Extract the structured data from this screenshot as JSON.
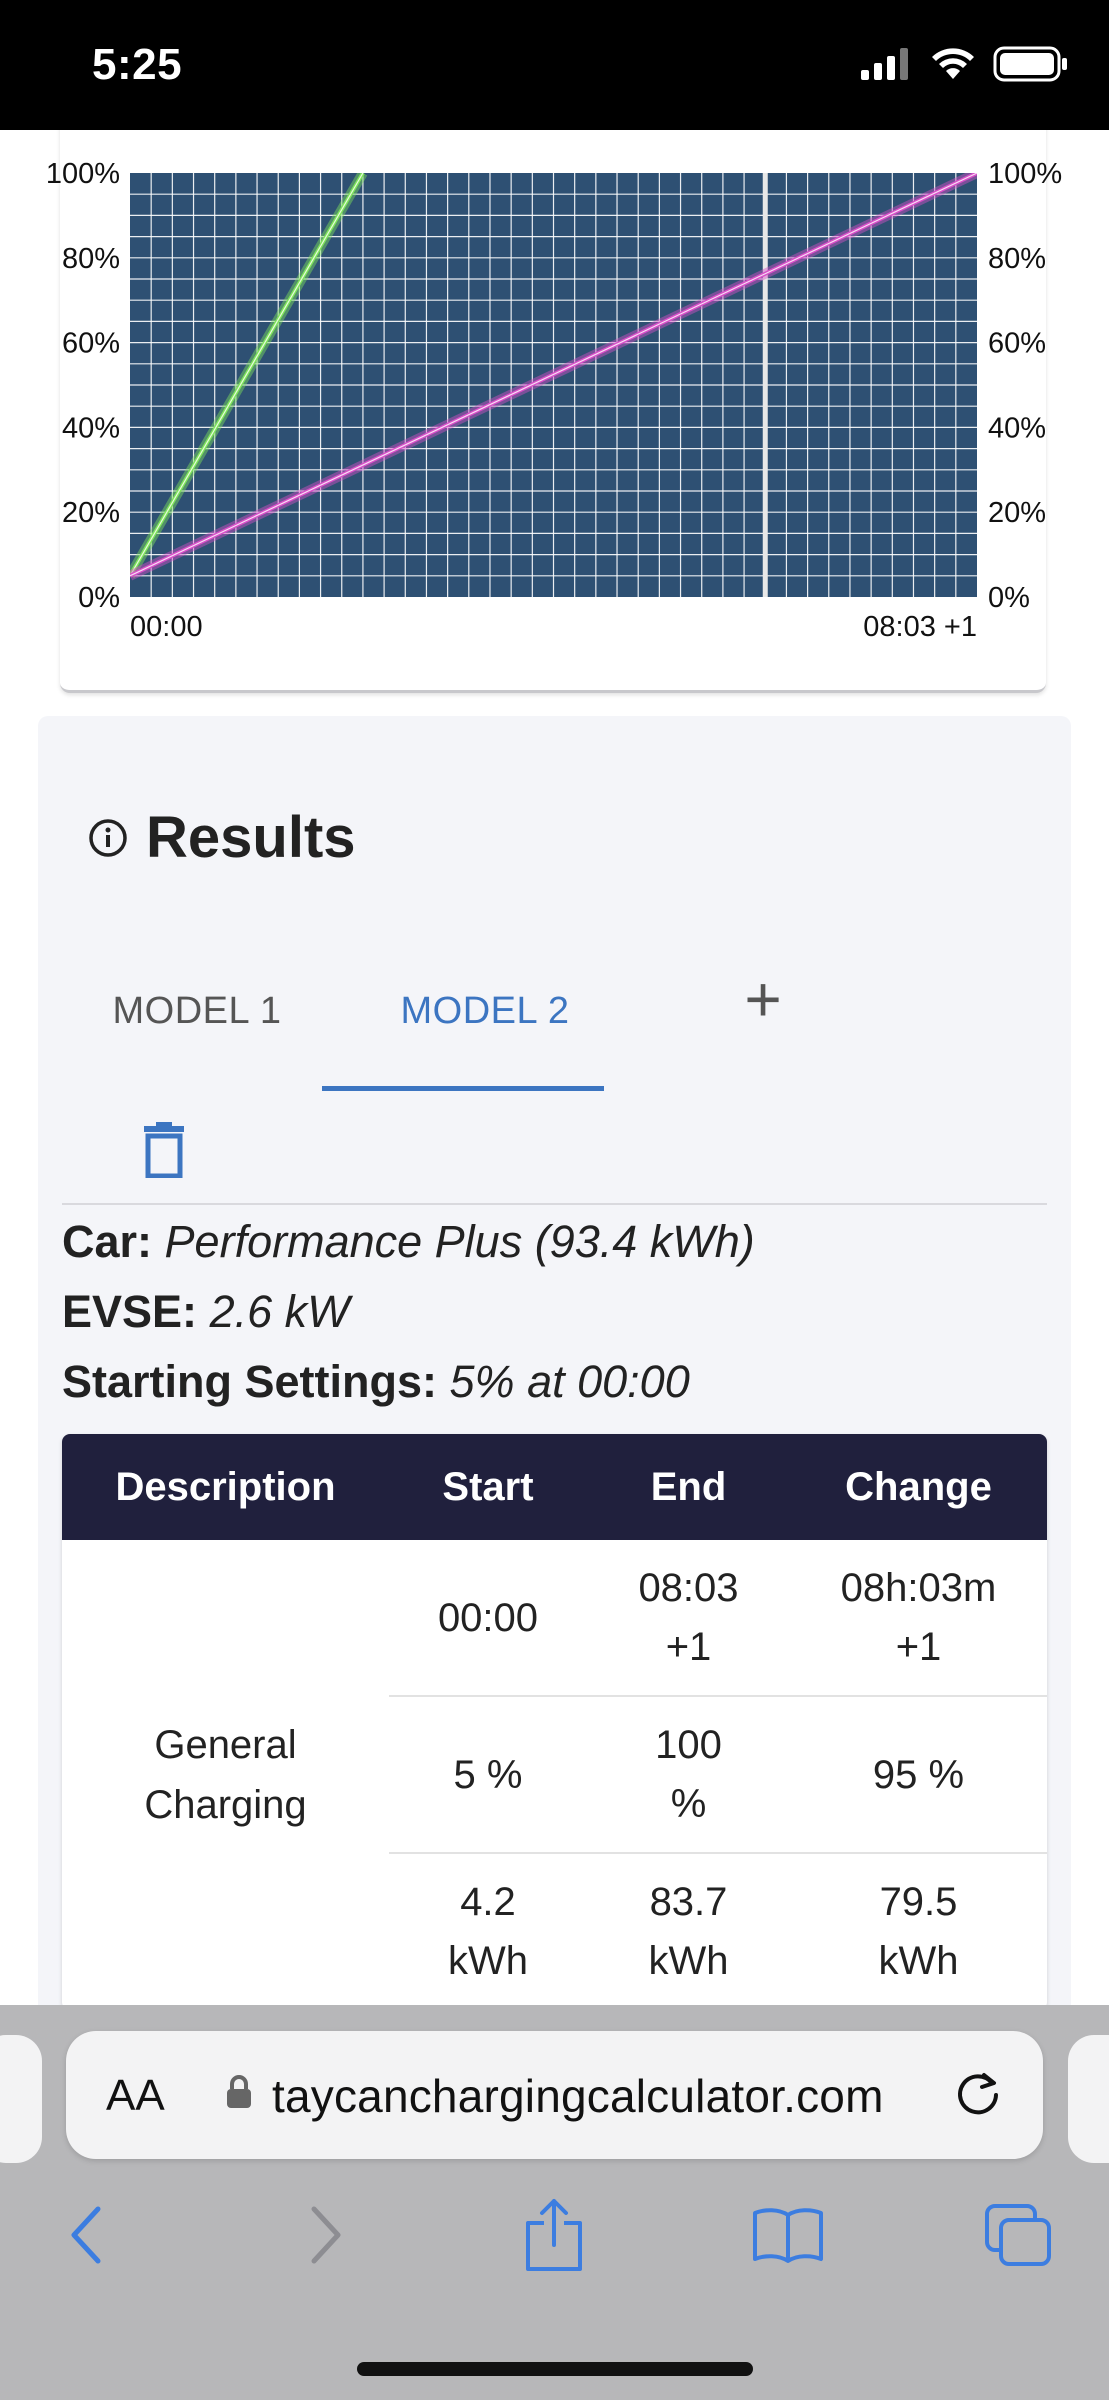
{
  "status_bar": {
    "time": "5:25"
  },
  "chart_data": {
    "type": "line",
    "x_tick_labels": [
      "00:00",
      "08:03 +1"
    ],
    "y_tick_labels": [
      "0%",
      "20%",
      "40%",
      "60%",
      "80%",
      "100%"
    ],
    "y_range": [
      0,
      100
    ],
    "grid": true,
    "series": [
      {
        "color": "#7ee35a",
        "x": [
          0,
          0.275
        ],
        "y": [
          5,
          100
        ]
      },
      {
        "color": "#d84fc8",
        "x": [
          0,
          1.0
        ],
        "y": [
          5,
          100
        ]
      }
    ],
    "marker_x": 0.75,
    "colors": {
      "background": "#2e5073",
      "grid": "#ffffff"
    }
  },
  "results": {
    "title": "Results",
    "tabs": [
      {
        "label": "MODEL 1"
      },
      {
        "label": "MODEL 2"
      }
    ],
    "add_tab_label": "+",
    "car_label": "Car:",
    "car_value": "Performance Plus (93.4 kWh)",
    "evse_label": "EVSE:",
    "evse_value": "2.6 kW",
    "start_label": "Starting Settings:",
    "start_value": "5% at 00:00",
    "table": {
      "headers": [
        "Description",
        "Start",
        "End",
        "Change"
      ],
      "description": [
        "General",
        "Charging"
      ],
      "rows": [
        {
          "start": [
            "00:00"
          ],
          "end": [
            "08:03",
            "+1"
          ],
          "change": [
            "08h:03m",
            "+1"
          ]
        },
        {
          "start": [
            "5 %"
          ],
          "end": [
            "100",
            "%"
          ],
          "change": [
            "95 %"
          ]
        },
        {
          "start": [
            "4.2",
            "kWh"
          ],
          "end": [
            "83.7",
            "kWh"
          ],
          "change": [
            "79.5",
            "kWh"
          ]
        }
      ]
    }
  },
  "browser": {
    "aa_label": "AA",
    "url": "taycanchargingcalculator.com"
  }
}
